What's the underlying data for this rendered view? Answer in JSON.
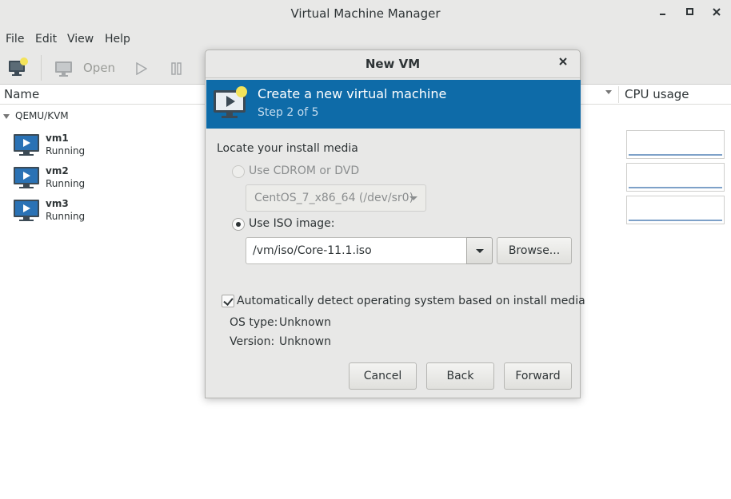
{
  "window": {
    "title": "Virtual Machine Manager",
    "minimize_icon": "minimize-icon",
    "maximize_icon": "maximize-icon",
    "close_icon": "close-icon"
  },
  "menu": {
    "file": "File",
    "edit": "Edit",
    "view": "View",
    "help": "Help"
  },
  "toolbar": {
    "open_label": "Open"
  },
  "columns": {
    "name": "Name",
    "cpu_usage": "CPU usage"
  },
  "connection": {
    "name": "QEMU/KVM"
  },
  "vms": [
    {
      "name": "vm1",
      "status": "Running"
    },
    {
      "name": "vm2",
      "status": "Running"
    },
    {
      "name": "vm3",
      "status": "Running"
    }
  ],
  "dialog": {
    "title": "New VM",
    "heading": "Create a new virtual machine",
    "step": "Step 2 of 5",
    "locate_label": "Locate your install media",
    "cdrom_option": "Use CDROM or DVD",
    "cdrom_device": "CentOS_7_x86_64 (/dev/sr0)",
    "iso_option": "Use ISO image:",
    "iso_path": "/vm/iso/Core-11.1.iso",
    "browse_label": "Browse...",
    "auto_detect_label": "Automatically detect operating system based on install media",
    "auto_detect_checked": true,
    "os_type_key": "OS type:",
    "os_type_value": "Unknown",
    "version_key": "Version:",
    "version_value": "Unknown",
    "cancel_label": "Cancel",
    "back_label": "Back",
    "forward_label": "Forward"
  },
  "colors": {
    "banner": "#0e6ba8",
    "window_bg": "#e8e8e7"
  }
}
